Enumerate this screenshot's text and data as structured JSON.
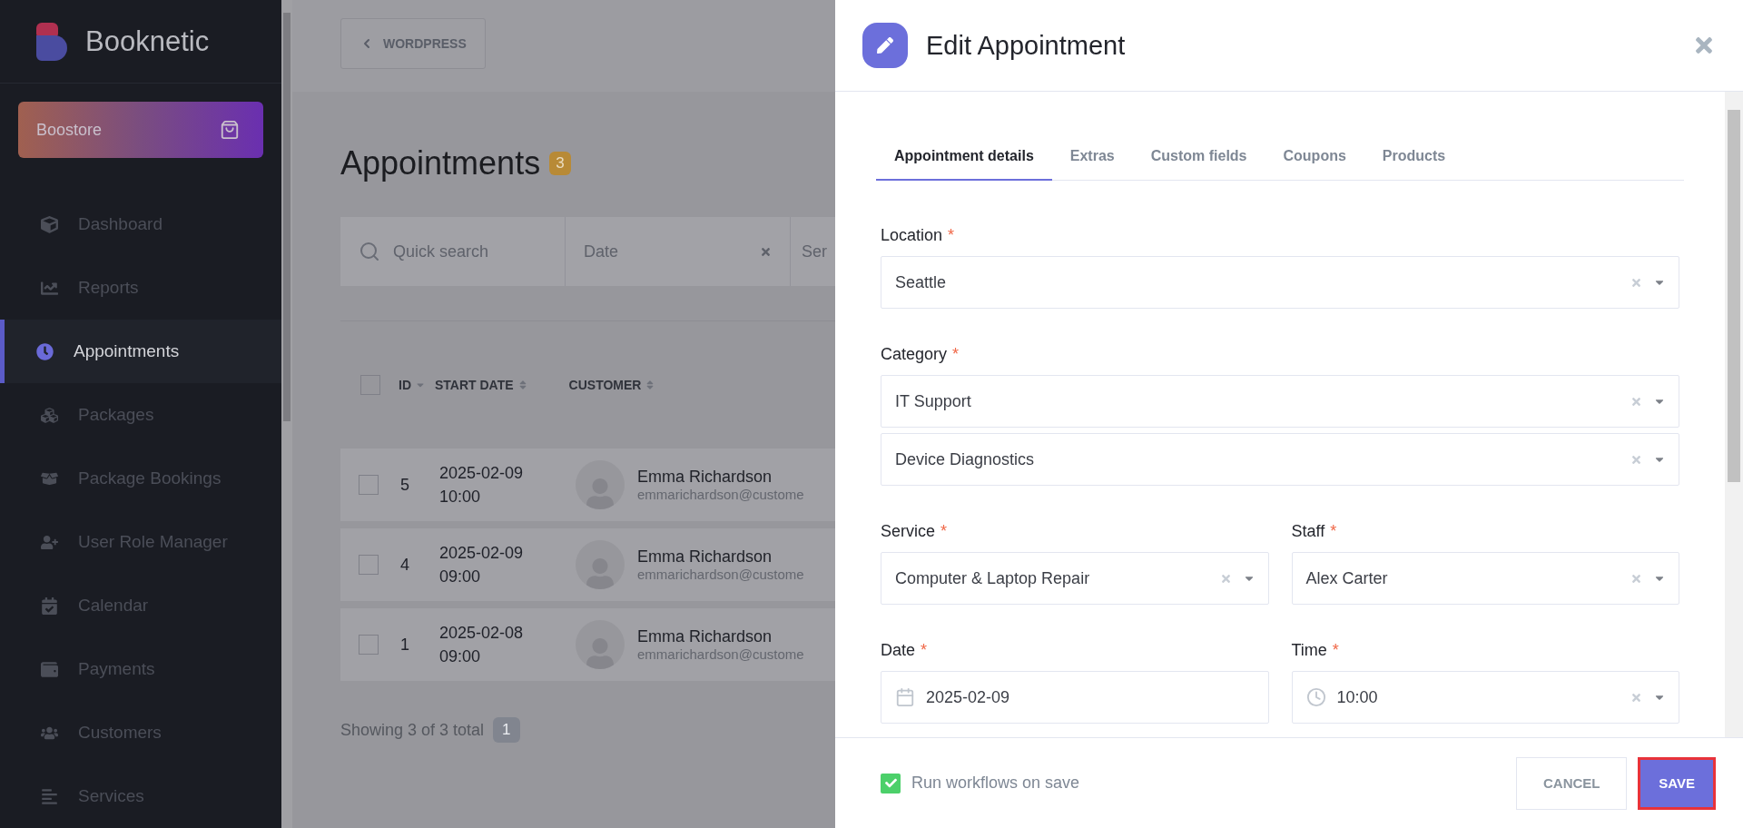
{
  "sidebar": {
    "brand": "Booknetic",
    "store_button": "Boostore",
    "items": [
      {
        "label": "Dashboard",
        "selected": false
      },
      {
        "label": "Reports",
        "selected": false
      },
      {
        "label": "Appointments",
        "selected": true
      },
      {
        "label": "Packages",
        "selected": false
      },
      {
        "label": "Package Bookings",
        "selected": false
      },
      {
        "label": "User Role Manager",
        "selected": false
      },
      {
        "label": "Calendar",
        "selected": false
      },
      {
        "label": "Payments",
        "selected": false
      },
      {
        "label": "Customers",
        "selected": false
      },
      {
        "label": "Services",
        "selected": false
      }
    ]
  },
  "main": {
    "back_button": "WORDPRESS",
    "title": "Appointments",
    "count": "3",
    "filters": [
      {
        "kind": "search",
        "placeholder": "Quick search"
      },
      {
        "kind": "clearable",
        "placeholder": "Date"
      },
      {
        "kind": "plain",
        "placeholder": "Ser"
      }
    ],
    "table": {
      "select_all_checked": false,
      "columns": [
        {
          "label": "ID",
          "sorted": true
        },
        {
          "label": "START DATE",
          "sorted": false
        },
        {
          "label": "CUSTOMER",
          "sorted": false
        }
      ],
      "rows": [
        {
          "checked": false,
          "id": "5",
          "date": "2025-02-09",
          "time": "10:00",
          "name": "Emma Richardson",
          "email": "emmarichardson@custome"
        },
        {
          "checked": false,
          "id": "4",
          "date": "2025-02-09",
          "time": "09:00",
          "name": "Emma Richardson",
          "email": "emmarichardson@custome"
        },
        {
          "checked": false,
          "id": "1",
          "date": "2025-02-08",
          "time": "09:00",
          "name": "Emma Richardson",
          "email": "emmarichardson@custome"
        }
      ]
    },
    "summary": "Showing 3 of 3 total",
    "page": "1"
  },
  "panel": {
    "title": "Edit Appointment",
    "tabs": [
      {
        "label": "Appointment details",
        "selected": true
      },
      {
        "label": "Extras",
        "selected": false
      },
      {
        "label": "Custom fields",
        "selected": false
      },
      {
        "label": "Coupons",
        "selected": false
      },
      {
        "label": "Products",
        "selected": false
      }
    ],
    "rows": [
      {
        "fields": [
          {
            "label": "Location",
            "required_mark": "*",
            "kind": "select",
            "values": [
              "Seattle"
            ]
          }
        ]
      },
      {
        "fields": [
          {
            "label": "Category",
            "required_mark": "*",
            "kind": "select",
            "values": [
              "IT Support",
              "Device Diagnostics"
            ]
          }
        ]
      },
      {
        "fields": [
          {
            "label": "Service",
            "required_mark": "*",
            "kind": "select",
            "values": [
              "Computer & Laptop Repair"
            ]
          },
          {
            "label": "Staff",
            "required_mark": "*",
            "kind": "select",
            "values": [
              "Alex Carter"
            ]
          }
        ]
      },
      {
        "fields": [
          {
            "label": "Date",
            "required_mark": "*",
            "kind": "date",
            "values": [
              "2025-02-09"
            ]
          },
          {
            "label": "Time",
            "required_mark": "*",
            "kind": "time",
            "values": [
              "10:00"
            ]
          }
        ]
      }
    ],
    "workflow_checkbox": {
      "label": "Run workflows on save",
      "checked": true
    },
    "buttons": [
      {
        "kind": "cancel",
        "label": "CANCEL"
      },
      {
        "kind": "save",
        "label": "SAVE"
      }
    ]
  }
}
